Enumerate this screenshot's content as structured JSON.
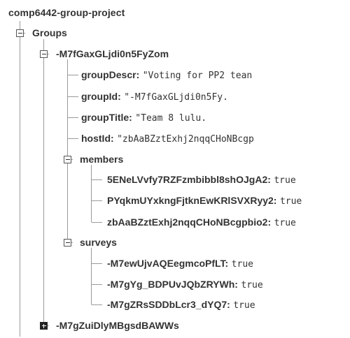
{
  "root": {
    "label": "comp6442-group-project"
  },
  "groups": {
    "label": "Groups",
    "group1": {
      "key": "-M7fGaxGLjdi0n5FyZom",
      "fields": {
        "groupDescr": {
          "key": "groupDescr:",
          "value": "\"Voting for PP2 tean"
        },
        "groupId": {
          "key": "groupId:",
          "value": "\"-M7fGaxGLjdi0n5Fy."
        },
        "groupTitle": {
          "key": "groupTitle:",
          "value": "\"Team 8 lulu."
        },
        "hostId": {
          "key": "hostId:",
          "value": "\"zbAaBZztExhj2nqqCHoNBcgp"
        }
      },
      "members": {
        "label": "members",
        "items": [
          {
            "key": "5ENeLVvfy7RZFzmbibbl8shOJgA2:",
            "value": "true"
          },
          {
            "key": "PYqkmUYxkngFjtknEwKRlSVXRyy2:",
            "value": "true"
          },
          {
            "key": "zbAaBZztExhj2nqqCHoNBcgpbio2:",
            "value": "true"
          }
        ]
      },
      "surveys": {
        "label": "surveys",
        "items": [
          {
            "key": "-M7ewUjvAQEegmcoPfLT:",
            "value": "true"
          },
          {
            "key": "-M7gYg_BDPUvJQbZRYWh:",
            "value": "true"
          },
          {
            "key": "-M7gZRsSDDbLcr3_dYQ7:",
            "value": "true"
          }
        ]
      }
    },
    "group2": {
      "key": "-M7gZuiDlyMBgsdBAWWs"
    }
  }
}
